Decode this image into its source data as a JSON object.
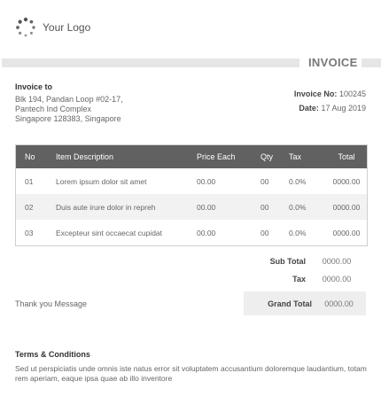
{
  "logo": {
    "text": "Your Logo",
    "icon": "spinner-dots-icon"
  },
  "title": "INVOICE",
  "bill_to": {
    "label": "Invoice to",
    "lines": [
      "Blk 194, Pandan Loop #02-17,",
      "Pantech Ind Complex",
      "Singapore 128383, Singapore"
    ]
  },
  "meta": {
    "invoice_no_label": "Invoice No:",
    "invoice_no": "100245",
    "date_label": "Date:",
    "date": "17 Aug 2019"
  },
  "table": {
    "headers": [
      "No",
      "Item Description",
      "Price Each",
      "Qty",
      "Tax",
      "Total"
    ],
    "rows": [
      [
        "01",
        "Lorem ipsum dolor sit amet",
        "00.00",
        "00",
        "0.0%",
        "0000.00"
      ],
      [
        "02",
        "Duis aute irure dolor in repreh",
        "00.00",
        "00",
        "0.0%",
        "0000.00"
      ],
      [
        "03",
        "Excepteur sint occaecat cupidat",
        "00.00",
        "00",
        "0.0%",
        "0000.00"
      ]
    ]
  },
  "summary": {
    "subtotal_label": "Sub Total",
    "subtotal": "0000.00",
    "tax_label": "Tax",
    "tax": "0000.00",
    "grand_total_label": "Grand Total",
    "grand_total": "0000.00"
  },
  "thanks": "Thank you Message",
  "terms": {
    "title": "Terms & Conditions",
    "text": "Sed ut perspiciatis unde omnis iste natus error sit voluptatem accusantium doloremque laudantium, totam rem aperiam, eaque ipsa quae ab illo inventore"
  },
  "colors": {
    "header_bg": "#616161",
    "band": "#e6e6e6",
    "alt_row": "#f2f2f2"
  }
}
